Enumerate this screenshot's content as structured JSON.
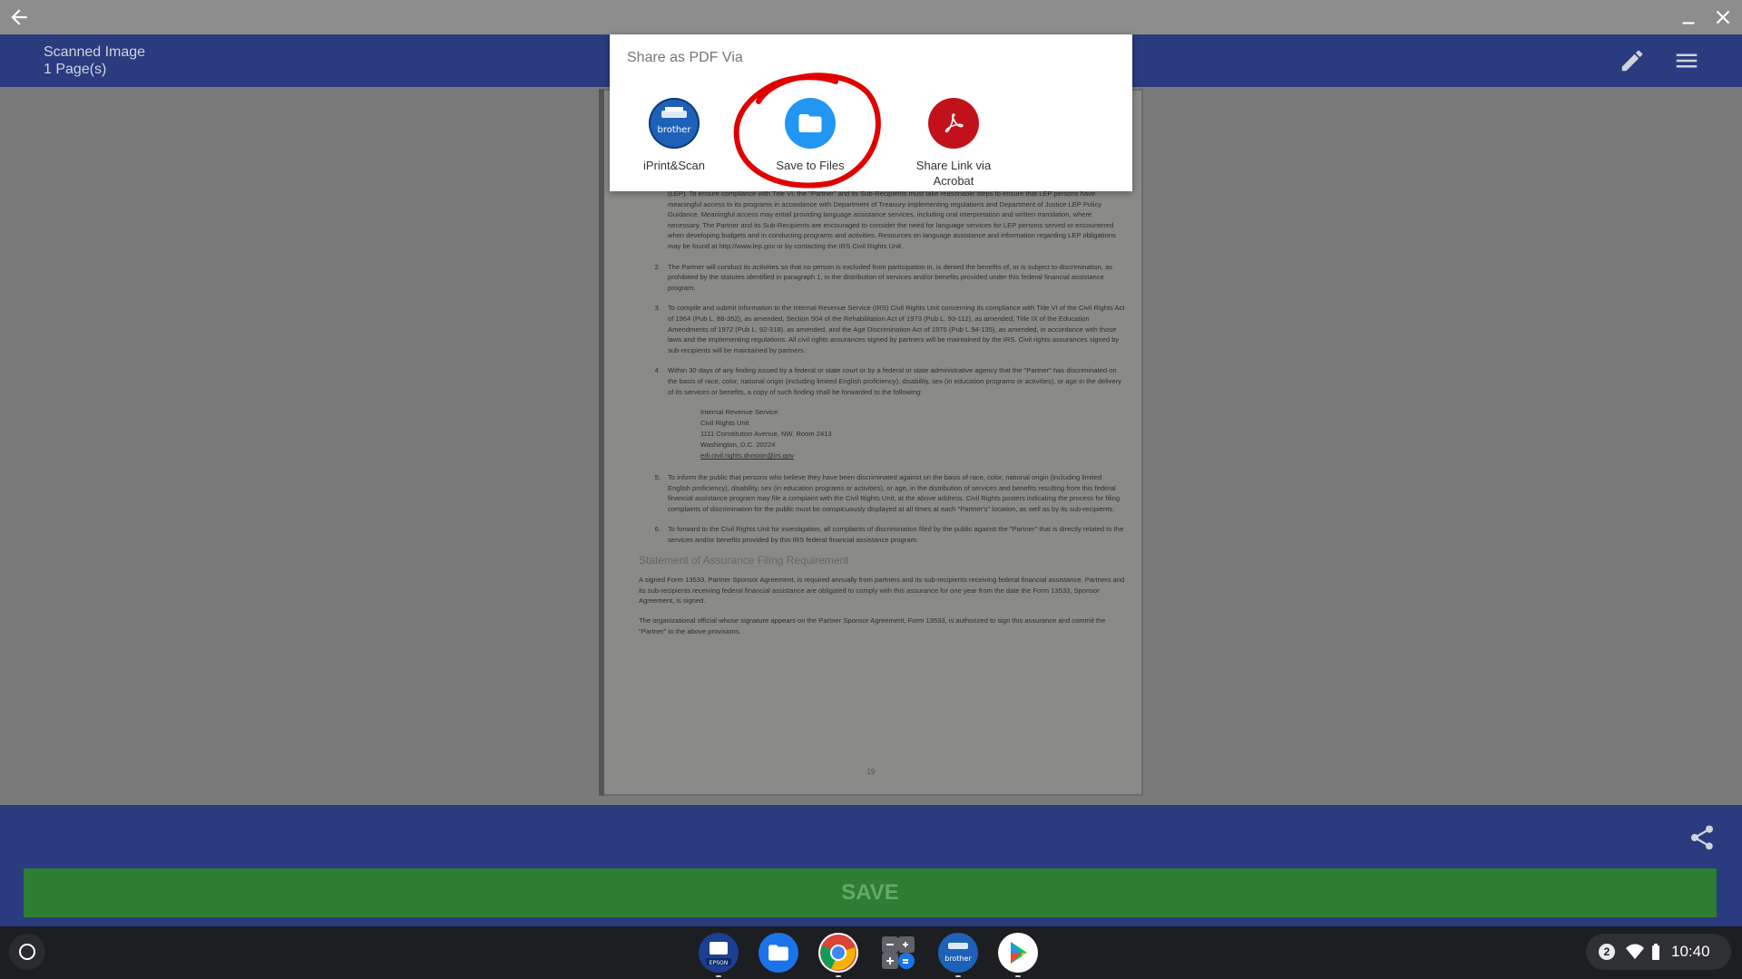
{
  "window": {
    "back_icon": "arrow-left-icon",
    "minimize_icon": "minimize-icon",
    "close_icon": "close-icon"
  },
  "header": {
    "title": "Scanned Image",
    "subtitle": "1 Page(s)",
    "edit_icon": "pencil-icon",
    "menu_icon": "hamburger-menu-icon",
    "bg_color": "#2a3b7f"
  },
  "document": {
    "items": [
      {
        "num": "",
        "text": "(LEP). To ensure compliance with Title VI, the \"Partner\" and its Sub-Recipients must take reasonable steps to ensure that LEP persons have meaningful access to its programs in accordance with Department of Treasury implementing regulations and Department of Justice LEP Policy Guidance. Meaningful access may entail providing language assistance services, including oral interpretation and written translation, where necessary. The Partner and its Sub-Recipients are encouraged to consider the need for language services for LEP persons served or encountered when developing budgets and in conducting programs and activities. Resources on language assistance and information regarding LEP obligations may be found at http://www.lep.gov or by contacting the IRS Civil Rights Unit."
      },
      {
        "num": "2.",
        "text": "The Partner will conduct its activities so that no person is excluded from participation in, is denied the benefits of, or is subject to discrimination, as prohibited by the statutes identified in paragraph 1, in the distribution of services and/or benefits provided under this federal financial assistance program."
      },
      {
        "num": "3.",
        "text": "To compile and submit information to the Internal Revenue Service (IRS) Civil Rights Unit concerning its compliance with Title VI of the Civil Rights Act of 1964 (Pub L. 88-352), as amended, Section 504 of the Rehabilitation Act of 1973 (Pub L. 93-112), as amended, Title IX of the Education Amendments of 1972 (Pub L. 92-318), as amended, and the Age Discrimination Act of 1975 (Pub L.94-135), as amended, in accordance with those laws and the implementing regulations. All civil rights assurances signed by partners will be maintained by the IRS. Civil rights assurances signed by sub-recipients will be maintained by partners."
      },
      {
        "num": "4.",
        "text": "Within 30 days of any finding issued by a federal or state court or by a federal or state administrative agency that the \"Partner\" has discriminated on the basis of race, color, national origin (including limited English proficiency), disability, sex (in education programs or activities), or age in the delivery of its services or benefits, a copy of such finding shall be forwarded to the following:"
      }
    ],
    "address": [
      "Internal Revenue Service",
      "Civil Rights Unit",
      "1111 Constitution Avenue, NW, Room 2413",
      "Washington, D.C. 20224",
      "edi.civil.rights.division@irs.gov"
    ],
    "items_after": [
      {
        "num": "5.",
        "text": "To inform the public that persons who believe they have been discriminated against on the basis of race, color, national origin (including limited English proficiency), disability, sex (in education programs or activities), or age, in the distribution of services and benefits resulting from this federal financial assistance program may file a complaint with the Civil Rights Unit, at the above address. Civil Rights posters indicating the process for filing complaints of discrimination for the public must be conspicuously displayed at all times at each \"Partner's\" location, as well as by its sub-recipients."
      },
      {
        "num": "6.",
        "text": "To forward to the Civil Rights Unit for investigation, all complaints of discrimination filed by the public against the \"Partner\" that is directly related to the services and/or benefits provided by this IRS federal financial assistance program."
      }
    ],
    "heading": "Statement of Assurance Filing Requirement",
    "para1": "A signed Form 13533, Partner Sponsor Agreement, is required annually from partners and its sub-recipients receiving federal financial assistance. Partners and its sub-recipients receiving federal financial assistance are obligated to comply with this assurance for one year from the date the Form 13533, Sponsor Agreement, is signed.",
    "para2": "The organizational official whose signature appears on the Partner Sponsor Agreement, Form 13533, is authorized to sign this assurance and commit the \"Partner\" to the above provisions.",
    "page_number": "19"
  },
  "dialog": {
    "title": "Share as PDF Via",
    "options": [
      {
        "label": "iPrint&Scan",
        "icon": "brother-app-icon",
        "color": "#1d62b8"
      },
      {
        "label": "Save to Files",
        "icon": "folder-icon",
        "color": "#2196f3"
      },
      {
        "label": "Share Link via Acrobat",
        "icon": "acrobat-icon",
        "color": "#c1121c"
      }
    ],
    "highlight_color": "#e00000"
  },
  "bottom": {
    "share_icon": "share-icon",
    "save_label": "SAVE",
    "save_color": "#2e7d32"
  },
  "shelf": {
    "launcher_icon": "launcher-circle-icon",
    "apps": [
      {
        "name": "epson-app-icon",
        "label": "EPSON"
      },
      {
        "name": "files-app-icon"
      },
      {
        "name": "chrome-icon"
      },
      {
        "name": "calculator-icon"
      },
      {
        "name": "brother-app-icon",
        "label": "brother"
      },
      {
        "name": "play-store-icon"
      }
    ],
    "notification_count": "2",
    "time": "10:40"
  }
}
